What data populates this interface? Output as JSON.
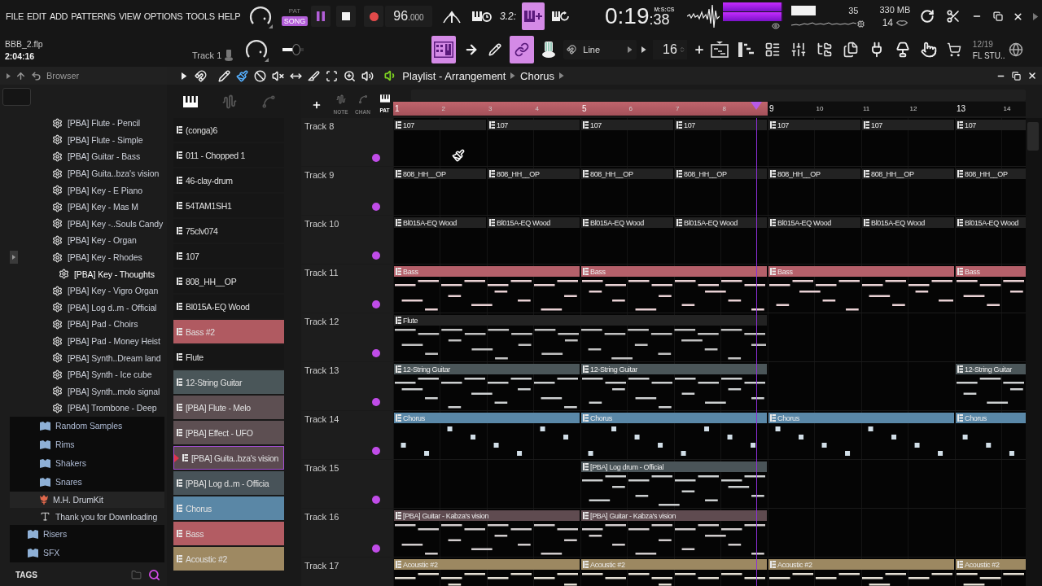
{
  "menu": [
    "FILE",
    "EDIT",
    "ADD",
    "PATTERNS",
    "VIEW",
    "OPTIONS",
    "TOOLS",
    "HELP"
  ],
  "transport": {
    "modes": [
      {
        "label": "PAT",
        "selected": false
      },
      {
        "label": "SONG",
        "selected": true
      }
    ],
    "playing": true,
    "tempo_whole": "96",
    "tempo_fraction": ".000",
    "toggles": [
      {
        "selected": false
      },
      {
        "selected": false
      },
      {
        "selected": false,
        "label": "3.2:"
      },
      {
        "selected": true
      },
      {
        "selected": false
      }
    ]
  },
  "clock": {
    "main": "0:19",
    "sub": ":38",
    "format": "M:S:CS"
  },
  "meters": [
    {
      "level": 0.97
    },
    {
      "level": 0.97
    }
  ],
  "monitor": {
    "reading": "35",
    "memory": "330 MB",
    "polyphony": "14"
  },
  "project": {
    "file": "BBB_2.flp",
    "length": "2:04:16",
    "hint": "Track 1",
    "pitch": {
      "level": 0.75
    }
  },
  "tools": [
    {
      "selected": true
    },
    {
      "selected": false
    },
    {
      "selected": false
    },
    {
      "selected": true
    },
    {
      "selected": false
    }
  ],
  "snap": "Line",
  "step": "16",
  "news": {
    "date": "12/19",
    "title": "FL STU.."
  },
  "browser": {
    "title": "Browser",
    "tree": [
      {
        "children": [
          {
            "children": [
              {
                "label": "[PBA] Flute - Pencil",
                "kind": "preset",
                "selected": false
              },
              {
                "label": "[PBA] Flute - Simple",
                "kind": "preset",
                "selected": false
              },
              {
                "label": "[PBA] Guitar - Bass",
                "kind": "preset",
                "selected": false
              },
              {
                "label": "[PBA] Guita..bza's vision",
                "kind": "preset",
                "selected": false
              },
              {
                "label": "[PBA] Key - E Piano",
                "kind": "preset",
                "selected": false
              },
              {
                "label": "[PBA] Key - Mas M",
                "kind": "preset",
                "selected": false
              },
              {
                "label": "[PBA] Key -..Souls Candy",
                "kind": "preset",
                "selected": false
              },
              {
                "label": "[PBA] Key - Organ",
                "kind": "preset",
                "selected": false
              },
              {
                "label": "[PBA] Key - Rhodes",
                "kind": "preset",
                "selected": false
              },
              {
                "label": "[PBA] Key - Thoughts",
                "kind": "preset",
                "selected": true
              },
              {
                "label": "[PBA] Key - Vigro Organ",
                "kind": "preset",
                "selected": false
              },
              {
                "label": "[PBA] Log d..m - Official",
                "kind": "preset",
                "selected": false
              },
              {
                "label": "[PBA] Pad - Choirs",
                "kind": "preset",
                "selected": false
              },
              {
                "label": "[PBA] Pad - Money Heist",
                "kind": "preset",
                "selected": false
              },
              {
                "label": "[PBA] Synth..Dream land",
                "kind": "preset",
                "selected": false
              },
              {
                "label": "[PBA] Synth - Ice cube",
                "kind": "preset",
                "selected": false
              },
              {
                "label": "[PBA] Synth..molo signal",
                "kind": "preset",
                "selected": false
              },
              {
                "label": "[PBA] Trombone - Deep",
                "kind": "preset",
                "selected": false
              }
            ]
          },
          {
            "label": "Random Samples",
            "kind": "folder",
            "selected": false
          },
          {
            "label": "Rims",
            "kind": "folder",
            "selected": false
          },
          {
            "label": "Shakers",
            "kind": "folder",
            "selected": false
          },
          {
            "label": "Snares",
            "kind": "folder",
            "selected": false
          },
          {
            "label": "M.H. DrumKit",
            "kind": "kit",
            "selected": false
          },
          {
            "label": "Thank you for Downloading",
            "kind": "text",
            "selected": false
          }
        ]
      },
      {
        "label": "Risers",
        "kind": "folder",
        "selected": false
      },
      {
        "label": "SFX",
        "kind": "folder",
        "selected": false
      }
    ],
    "footer": "TAGS"
  },
  "playlist": {
    "title": "Playlist - Arrangement",
    "pattern": "Chorus",
    "tools": [
      {
        "selected": false
      },
      {
        "selected": false
      },
      {
        "selected": true
      },
      {
        "selected": false
      },
      {
        "selected": false
      },
      {
        "selected": false
      },
      {
        "selected": false
      },
      {
        "selected": false
      },
      {
        "selected": false
      },
      {
        "selected": false
      }
    ],
    "list_tabs": [
      {
        "selected": true
      },
      {
        "selected": false
      },
      {
        "selected": false
      }
    ],
    "filters": [
      {
        "label": "NOTE",
        "selected": false
      },
      {
        "label": "CHAN",
        "selected": false
      },
      {
        "label": "PAT",
        "selected": true
      }
    ],
    "patterns": [
      {
        "label": "(conga)6",
        "color": "#161616",
        "selected": false
      },
      {
        "label": "011 - Chopped 1",
        "color": "#161616",
        "selected": false
      },
      {
        "label": "46-clay-drum",
        "color": "#161616",
        "selected": false
      },
      {
        "label": "54TAM1SH1",
        "color": "#161616",
        "selected": false
      },
      {
        "label": "75clv074",
        "color": "#161616",
        "selected": false
      },
      {
        "label": "107",
        "color": "#161616",
        "selected": false
      },
      {
        "label": "808_HH__OP",
        "color": "#161616",
        "selected": false
      },
      {
        "label": "Bl015A-EQ Wood",
        "color": "#161616",
        "selected": false
      },
      {
        "label": "Bass #2",
        "color": "#b05a61",
        "selected": false
      },
      {
        "label": "Flute",
        "color": "#161616",
        "selected": false
      },
      {
        "label": "12-String Guitar",
        "color": "#4a5659",
        "selected": false
      },
      {
        "label": "[PBA] Flute - Melo",
        "color": "#5d4f52",
        "selected": false
      },
      {
        "label": "[PBA] Effect - UFO",
        "color": "#5d4f52",
        "selected": false
      },
      {
        "label": "[PBA] Guita..bza's vision",
        "color": "#5b4a50",
        "selected": true
      },
      {
        "label": "[PBA] Log d..m - Officia",
        "color": "#485359",
        "selected": false
      },
      {
        "label": "Chorus",
        "color": "#5a87a6",
        "selected": false
      },
      {
        "label": "Bass",
        "color": "#b35c63",
        "selected": false
      },
      {
        "label": "Acoustic #2",
        "color": "#9e8962",
        "selected": false
      }
    ],
    "ruler": [
      {
        "label": "1",
        "in_loop": true,
        "playhead": false
      },
      {
        "label": "2",
        "in_loop": true,
        "playhead": false
      },
      {
        "label": "3",
        "in_loop": true,
        "playhead": false
      },
      {
        "label": "4",
        "in_loop": true,
        "playhead": false
      },
      {
        "label": "5",
        "in_loop": true,
        "playhead": false
      },
      {
        "label": "6",
        "in_loop": true,
        "playhead": false
      },
      {
        "label": "7",
        "in_loop": true,
        "playhead": false
      },
      {
        "label": "8",
        "in_loop": true,
        "playhead": true
      },
      {
        "label": "9",
        "in_loop": false,
        "playhead": false
      },
      {
        "label": "10",
        "in_loop": false,
        "playhead": false
      },
      {
        "label": "11",
        "in_loop": false,
        "playhead": false
      },
      {
        "label": "12",
        "in_loop": false,
        "playhead": false
      },
      {
        "label": "13",
        "in_loop": false,
        "playhead": false
      },
      {
        "label": "14",
        "in_loop": false,
        "playhead": false
      }
    ],
    "tracks": [
      {
        "name": "Track 8",
        "enabled": true,
        "kind": "oneshot",
        "color": "#222222",
        "cells": [
          {
            "kind": "start",
            "label": "107"
          },
          {
            "kind": "hold"
          },
          {
            "kind": "start",
            "label": "107"
          },
          {
            "kind": "hold"
          },
          {
            "kind": "start",
            "label": "107"
          },
          {
            "kind": "hold"
          },
          {
            "kind": "start",
            "label": "107"
          },
          {
            "kind": "hold"
          },
          {
            "kind": "start",
            "label": "107"
          },
          {
            "kind": "hold"
          },
          {
            "kind": "start",
            "label": "107"
          },
          {
            "kind": "hold"
          },
          {
            "kind": "start",
            "label": "107"
          },
          {
            "kind": "hold"
          }
        ]
      },
      {
        "name": "Track 9",
        "enabled": true,
        "kind": "oneshot",
        "color": "#222222",
        "cells": [
          {
            "kind": "start",
            "label": "808_HH__OP"
          },
          {
            "kind": "hold"
          },
          {
            "kind": "start",
            "label": "808_HH__OP"
          },
          {
            "kind": "hold"
          },
          {
            "kind": "start",
            "label": "808_HH__OP"
          },
          {
            "kind": "hold"
          },
          {
            "kind": "start",
            "label": "808_HH__OP"
          },
          {
            "kind": "hold"
          },
          {
            "kind": "start",
            "label": "808_HH__OP"
          },
          {
            "kind": "hold"
          },
          {
            "kind": "start",
            "label": "808_HH__OP"
          },
          {
            "kind": "hold"
          },
          {
            "kind": "start",
            "label": "808_HH__OP"
          },
          {
            "kind": "hold"
          }
        ]
      },
      {
        "name": "Track 10",
        "enabled": true,
        "kind": "oneshot",
        "color": "#222222",
        "cells": [
          {
            "kind": "start",
            "label": "Bl015A-EQ Wood"
          },
          {
            "kind": "hold"
          },
          {
            "kind": "start",
            "label": "Bl015A-EQ Wood"
          },
          {
            "kind": "hold"
          },
          {
            "kind": "start",
            "label": "Bl015A-EQ Wood"
          },
          {
            "kind": "hold"
          },
          {
            "kind": "start",
            "label": "Bl015A-EQ Wood"
          },
          {
            "kind": "hold"
          },
          {
            "kind": "start",
            "label": "Bl015A-EQ Wood"
          },
          {
            "kind": "hold"
          },
          {
            "kind": "start",
            "label": "Bl015A-EQ Wood"
          },
          {
            "kind": "hold"
          },
          {
            "kind": "start",
            "label": "Bl015A-EQ Wood"
          },
          {
            "kind": "hold"
          }
        ]
      },
      {
        "name": "Track 11",
        "enabled": true,
        "kind": "notes",
        "color": "#b5606a",
        "cells": [
          {
            "kind": "start",
            "label": "Bass"
          },
          {
            "kind": "hold"
          },
          {
            "kind": "hold"
          },
          {
            "kind": "hold"
          },
          {
            "kind": "start",
            "label": "Bass"
          },
          {
            "kind": "hold"
          },
          {
            "kind": "hold"
          },
          {
            "kind": "hold"
          },
          {
            "kind": "start",
            "label": "Bass"
          },
          {
            "kind": "hold"
          },
          {
            "kind": "hold"
          },
          {
            "kind": "hold"
          },
          {
            "kind": "start",
            "label": "Bass"
          },
          {
            "kind": "hold"
          }
        ]
      },
      {
        "name": "Track 12",
        "enabled": true,
        "kind": "notes",
        "color": "#232323",
        "cells": [
          {
            "kind": "start",
            "label": "Flute"
          },
          {
            "kind": "hold"
          },
          {
            "kind": "hold"
          },
          {
            "kind": "hold"
          },
          {
            "kind": "hold"
          },
          {
            "kind": "hold"
          },
          {
            "kind": "hold"
          },
          {
            "kind": "hold"
          },
          {
            "kind": "empty"
          },
          {
            "kind": "empty"
          },
          {
            "kind": "empty"
          },
          {
            "kind": "empty"
          },
          {
            "kind": "empty"
          },
          {
            "kind": "empty"
          }
        ]
      },
      {
        "name": "Track 13",
        "enabled": true,
        "kind": "notes",
        "color": "#4b5659",
        "cells": [
          {
            "kind": "start",
            "label": "12-String Guitar"
          },
          {
            "kind": "hold"
          },
          {
            "kind": "hold"
          },
          {
            "kind": "hold"
          },
          {
            "kind": "start",
            "label": "12-String Guitar"
          },
          {
            "kind": "hold"
          },
          {
            "kind": "hold"
          },
          {
            "kind": "hold"
          },
          {
            "kind": "empty"
          },
          {
            "kind": "empty"
          },
          {
            "kind": "empty"
          },
          {
            "kind": "empty"
          },
          {
            "kind": "start",
            "label": "12-String Guitar"
          },
          {
            "kind": "hold"
          }
        ]
      },
      {
        "name": "Track 14",
        "enabled": true,
        "kind": "hits",
        "color": "#5a88a8",
        "cells": [
          {
            "kind": "start",
            "label": "Chorus"
          },
          {
            "kind": "hold"
          },
          {
            "kind": "hold"
          },
          {
            "kind": "hold"
          },
          {
            "kind": "start",
            "label": "Chorus"
          },
          {
            "kind": "hold"
          },
          {
            "kind": "hold"
          },
          {
            "kind": "hold"
          },
          {
            "kind": "start",
            "label": "Chorus"
          },
          {
            "kind": "hold"
          },
          {
            "kind": "hold"
          },
          {
            "kind": "hold"
          },
          {
            "kind": "start",
            "label": "Chorus"
          },
          {
            "kind": "hold"
          }
        ]
      },
      {
        "name": "Track 15",
        "enabled": true,
        "kind": "notes",
        "color": "#4a5458",
        "cells": [
          {
            "kind": "empty"
          },
          {
            "kind": "empty"
          },
          {
            "kind": "empty"
          },
          {
            "kind": "empty"
          },
          {
            "kind": "start",
            "label": "[PBA] Log drum - Official"
          },
          {
            "kind": "hold"
          },
          {
            "kind": "hold"
          },
          {
            "kind": "hold"
          },
          {
            "kind": "empty"
          },
          {
            "kind": "empty"
          },
          {
            "kind": "empty"
          },
          {
            "kind": "empty"
          },
          {
            "kind": "empty"
          },
          {
            "kind": "empty"
          }
        ]
      },
      {
        "name": "Track 16",
        "enabled": true,
        "kind": "notes",
        "color": "#5f4b50",
        "cells": [
          {
            "kind": "start",
            "label": "[PBA] Guitar - Kabza's vision"
          },
          {
            "kind": "hold"
          },
          {
            "kind": "hold"
          },
          {
            "kind": "hold"
          },
          {
            "kind": "start",
            "label": "[PBA] Guitar - Kabza's vision"
          },
          {
            "kind": "hold"
          },
          {
            "kind": "hold"
          },
          {
            "kind": "hold"
          },
          {
            "kind": "empty"
          },
          {
            "kind": "empty"
          },
          {
            "kind": "empty"
          },
          {
            "kind": "empty"
          },
          {
            "kind": "empty"
          },
          {
            "kind": "empty"
          }
        ]
      },
      {
        "name": "Track 17",
        "kind": "notes",
        "color": "#9c8861",
        "cells": [
          {
            "kind": "start",
            "label": "Acoustic #2"
          },
          {
            "kind": "hold"
          },
          {
            "kind": "hold"
          },
          {
            "kind": "hold"
          },
          {
            "kind": "start",
            "label": "Acoustic #2"
          },
          {
            "kind": "hold"
          },
          {
            "kind": "hold"
          },
          {
            "kind": "hold"
          },
          {
            "kind": "start",
            "label": "Acoustic #2"
          },
          {
            "kind": "hold"
          },
          {
            "kind": "hold"
          },
          {
            "kind": "hold"
          },
          {
            "kind": "start",
            "label": "Acoustic #2"
          },
          {
            "kind": "hold"
          }
        ]
      }
    ]
  }
}
